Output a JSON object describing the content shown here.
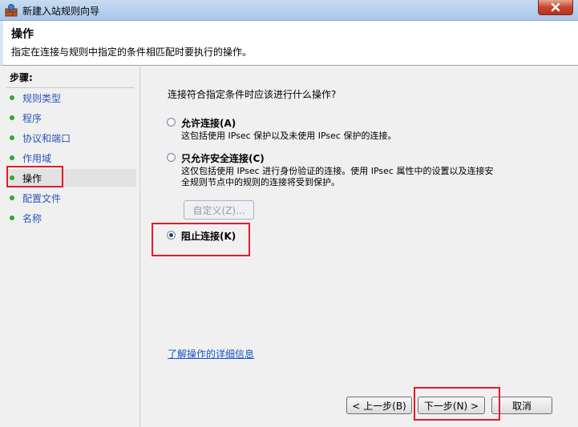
{
  "window": {
    "title": "新建入站规则向导",
    "app_icon": "firewall-wizard-icon",
    "close_icon": "close-icon"
  },
  "header": {
    "title": "操作",
    "description": "指定在连接与规则中指定的条件相匹配时要执行的操作。"
  },
  "steps": {
    "label": "步骤:",
    "items": [
      {
        "label": "规则类型"
      },
      {
        "label": "程序"
      },
      {
        "label": "协议和端口"
      },
      {
        "label": "作用域"
      },
      {
        "label": "操作",
        "active": true
      },
      {
        "label": "配置文件"
      },
      {
        "label": "名称"
      }
    ],
    "dot_color": "#3aa232"
  },
  "main": {
    "question": "连接符合指定条件时应该进行什么操作?",
    "options": [
      {
        "title": "允许连接(A)",
        "description": "这包括使用 IPsec 保护以及未使用 IPsec 保护的连接。",
        "checked": false
      },
      {
        "title": "只允许安全连接(C)",
        "description_line1": "这仅包括使用 IPsec 进行身份验证的连接。使用 IPsec 属性中的设置以及连接安",
        "description_line2": "全规则节点中的规则的连接将受到保护。",
        "checked": false
      },
      {
        "title": "阻止连接(K)",
        "checked": true
      }
    ],
    "customize_button": "自定义(Z)...",
    "learn_more_link": "了解操作的详细信息"
  },
  "footer": {
    "back_button": "< 上一步(B)",
    "next_button": "下一步(N) >",
    "cancel_button": "取消"
  },
  "highlight_color": "#e21b2b"
}
